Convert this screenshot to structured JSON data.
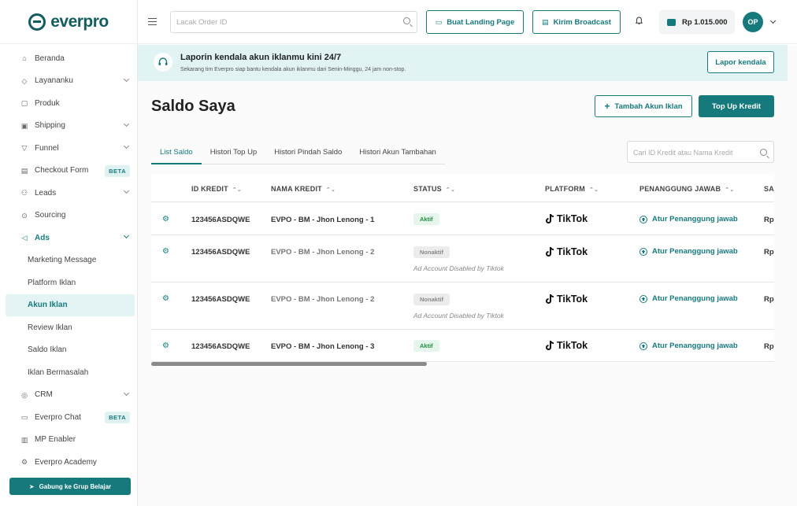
{
  "app": {
    "logo_text": "everpro"
  },
  "sidebar": {
    "items": [
      {
        "label": "Beranda",
        "icon": "home-icon",
        "chevron": false
      },
      {
        "label": "Layananku",
        "icon": "diamond-icon",
        "chevron": true
      },
      {
        "label": "Produk",
        "icon": "box-icon",
        "chevron": false
      },
      {
        "label": "Shipping",
        "icon": "truck-icon",
        "chevron": true
      },
      {
        "label": "Funnel",
        "icon": "funnel-icon",
        "chevron": true
      },
      {
        "label": "Checkout Form",
        "icon": "form-icon",
        "badge": "BETA"
      },
      {
        "label": "Leads",
        "icon": "people-icon",
        "chevron": true
      },
      {
        "label": "Sourcing",
        "icon": "sourcing-icon",
        "chevron": false
      },
      {
        "label": "Ads",
        "icon": "megaphone-icon",
        "chevron": true
      }
    ],
    "ads_sub": [
      "Marketing Message",
      "Platform Iklan",
      "Akun Iklan",
      "Review Iklan",
      "Saldo Iklan",
      "Iklan Bermasalah"
    ],
    "items_bottom": [
      {
        "label": "CRM",
        "icon": "crm-icon",
        "chevron": true
      },
      {
        "label": "Everpro Chat",
        "icon": "chat-icon",
        "badge": "BETA"
      },
      {
        "label": "MP Enabler",
        "icon": "mp-icon",
        "chevron": false
      },
      {
        "label": "Everpro Academy",
        "icon": "academy-icon",
        "chevron": false
      }
    ],
    "cta": "Gabung ke Grup Belajar"
  },
  "topbar": {
    "search_placeholder": "Lacak Order ID",
    "landing_btn": "Buat Landing Page",
    "broadcast_btn": "Kirim Broadcast",
    "balance": "Rp 1.015.000",
    "avatar": "OP"
  },
  "banner": {
    "title": "Laporin kendala akun iklanmu kini 24/7",
    "subtitle": "Sekarang tim Everpro siap bantu kendala akun iklanmu dari Senin-Minggu, 24 jam non-stop.",
    "button": "Lapor kendala"
  },
  "page": {
    "title": "Saldo Saya",
    "add_btn": "Tambah Akun Iklan",
    "topup_btn": "Top Up Kredit",
    "tabs": [
      "List Saldo",
      "Histori Top Up",
      "Histori Pindah Saldo",
      "Histori Akun Tambahan"
    ],
    "search_placeholder": "Cari ID Kredit atau Nama Kredit"
  },
  "table": {
    "columns": [
      "ID KREDIT",
      "NAMA KREDIT",
      "STATUS",
      "PLATFORM",
      "PENANGGUNG JAWAB",
      "SA"
    ],
    "rows": [
      {
        "id": "123456ASDQWE",
        "nama": "EVPO - BM - Jhon Lenong - 1",
        "status": "Aktif",
        "note": "",
        "platform": "TikTok",
        "pj": "Atur Penanggung jawab",
        "saldo": "Rp"
      },
      {
        "id": "123456ASDQWE",
        "nama": "EVPO - BM - Jhon Lenong - 2",
        "status": "Nonaktif",
        "note": "Ad Account Disabled by Tiktok",
        "platform": "TikTok",
        "pj": "Atur Penanggung jawab",
        "saldo": "Rp"
      },
      {
        "id": "123456ASDQWE",
        "nama": "EVPO - BM - Jhon Lenong - 2",
        "status": "Nonaktif",
        "note": "Ad Account Disabled by Tiktok",
        "platform": "TikTok",
        "pj": "Atur Penanggung jawab",
        "saldo": "Rp"
      },
      {
        "id": "123456ASDQWE",
        "nama": "EVPO - BM - Jhon Lenong - 3",
        "status": "Aktif",
        "note": "",
        "platform": "TikTok",
        "pj": "Atur Penanggung jawab",
        "saldo": "Rp"
      }
    ]
  },
  "colors": {
    "brand": "#167a7d",
    "banner": "#e1f3f3",
    "active_status": "#1f8f43"
  }
}
